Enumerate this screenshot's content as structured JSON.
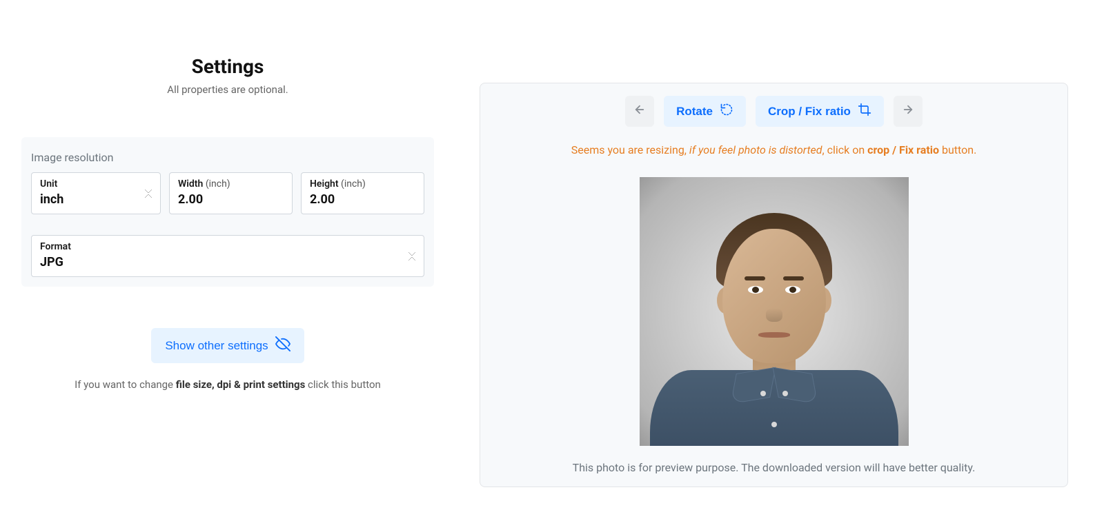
{
  "settings": {
    "title": "Settings",
    "subtitle": "All properties are optional.",
    "section_label": "Image resolution",
    "unit": {
      "label": "Unit",
      "value": "inch"
    },
    " Width": {
      "label": "Width",
      "hint": "(inch)",
      "value": "2.00"
    },
    "height": {
      "label": "Height",
      "hint": "(inch)",
      "value": "2.00"
    },
    "format": {
      "label": "Format",
      "value": "JPG"
    },
    "show_other_label": "Show other settings",
    "help_prefix": "If you want to change ",
    "help_bold": "file size, dpi & print settings",
    "help_suffix": " click this button"
  },
  "preview": {
    "rotate_label": "Rotate",
    "crop_label": "Crop / Fix ratio",
    "warning_prefix": "Seems you are resizing, ",
    "warning_italic": "if you feel photo is distorted",
    "warning_mid": ", click on ",
    "warning_bold": "crop / Fix ratio",
    "warning_suffix": " button.",
    "note": "This photo is for preview purpose. The downloaded version will have better quality."
  }
}
